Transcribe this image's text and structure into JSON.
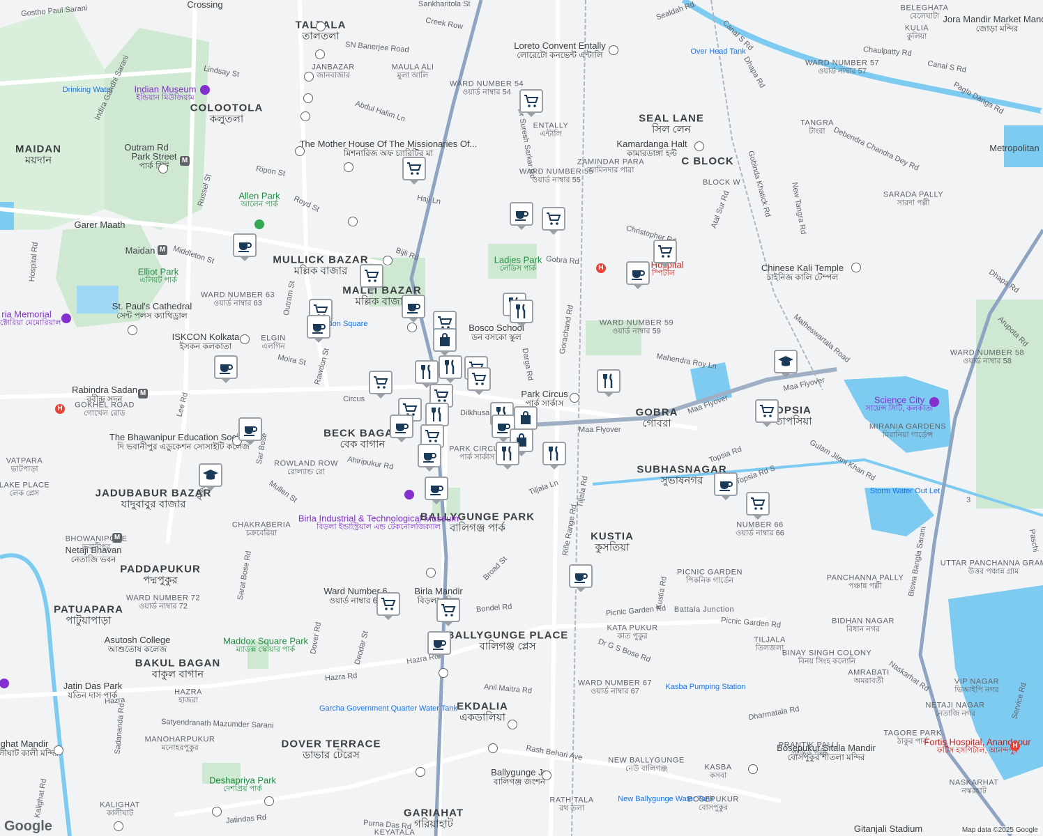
{
  "map": {
    "attribution": "Map data ©2025 Google",
    "logo": "Google",
    "colors": {
      "land": "#f2f3f4",
      "park": "#c8e6c9",
      "water": "#7ecbf1",
      "road": "#ffffff",
      "highway": "#8ea4c0",
      "rail": "#b0b6bd",
      "pin_icon": "#1a3a5a"
    }
  },
  "labels": {
    "taltala": {
      "en": "TALTALA",
      "bn": "তালতলা"
    },
    "colootola": {
      "en": "COLOOTOLA",
      "bn": "কলুতলা"
    },
    "maidan": {
      "en": "MAIDAN",
      "bn": "ময়দান"
    },
    "mullick_bazar": {
      "en": "MULLICK BAZAR",
      "bn": "মল্লিক বাজার"
    },
    "malli_bazar": {
      "en": "MALLI BAZAR",
      "bn": "মল্লিক বাজার"
    },
    "beck_bagan": {
      "en": "BECK BAGAN",
      "bn": "বেক বাগান"
    },
    "ballygunge_park": {
      "en": "BALLYGUNGE PARK",
      "bn": "বালিগঞ্জ পার্ক"
    },
    "ballygunge_place": {
      "en": "BALLYGUNGE PLACE",
      "bn": "বালিগঞ্জ প্লেস"
    },
    "ekdalia": {
      "en": "EKDALIA",
      "bn": "একডালিয়া"
    },
    "dover_terrace": {
      "en": "DOVER TERRACE",
      "bn": "ডাভার টেরেস"
    },
    "gariahat": {
      "en": "GARIAHAT",
      "bn": "গরিয়াহাট"
    },
    "seal_lane": {
      "en": "SEAL LANE",
      "bn": "সিল লেন"
    },
    "gobra": {
      "en": "GOBRA",
      "bn": "গোবরা"
    },
    "topsia": {
      "en": "OPSIA",
      "bn": "তাপসিয়া"
    },
    "subhasnagar": {
      "en": "SUBHASNAGAR",
      "bn": "সুভাষনগর"
    },
    "kustia": {
      "en": "KUSTIA",
      "bn": "কুসতিয়া"
    },
    "jadubabur_bazar": {
      "en": "JADUBABUR BAZAR",
      "bn": "যাদুবাবুর বাজার"
    },
    "paddapukur": {
      "en": "PADDAPUKUR",
      "bn": "পদ্মপুকুর"
    },
    "patuapara": {
      "en": "PATUAPARA",
      "bn": "পাটুয়াপাড়া"
    },
    "bakul_bagan": {
      "en": "BAKUL BAGAN",
      "bn": "বাকুল বাগান"
    },
    "c_block": {
      "en": "C BLOCK"
    },
    "vatpara": {
      "en": "VATPARA",
      "bn": "ভাটপাড়া"
    },
    "lake_place": {
      "en": "LAKE PLACE",
      "bn": "লেক প্লেস"
    },
    "bhowanipore": {
      "en": "BHOWANIPORE",
      "bn": "ভবানীপুর"
    },
    "chakraberia": {
      "en": "CHAKRABERIA",
      "bn": "চক্রবেরিয়া"
    },
    "janbazar": {
      "en": "JANBAZAR",
      "bn": "জানবাজার"
    },
    "maula_ali": {
      "en": "MAULA ALI",
      "bn": "মুলা আলি"
    },
    "entally": {
      "en": "ENTALLY",
      "bn": "এন্টালি"
    },
    "zamindar_para": {
      "en": "ZAMINDAR PARA",
      "bn": "জামিনদার পারা"
    },
    "block_w": {
      "en": "BLOCK W"
    },
    "tangra": {
      "en": "TANGRA",
      "bn": "টাংরা"
    },
    "kulia": {
      "en": "KULIA",
      "bn": "কুলিয়া"
    },
    "beleghata": {
      "en": "BELEGHATA",
      "bn": "বেলেঘাটা"
    },
    "sarada_pally": {
      "en": "SARADA PALLY",
      "bn": "সারদা পল্লী"
    },
    "elgin": {
      "en": "ELGIN",
      "bn": "এলগিন"
    },
    "rowland_row": {
      "en": "ROWLAND ROW",
      "bn": "রোল্যান্ড রো"
    },
    "hazra": {
      "en": "HAZRA",
      "bn": "হাজরা"
    },
    "manoharpukur": {
      "en": "MANOHARPUKUR",
      "bn": "মনোহরপুকুর"
    },
    "kalighat": {
      "en": "KALIGHAT",
      "bn": "কালীঘাট"
    },
    "kata_pukur": {
      "en": "KATA PUKUR",
      "bn": "কাত পুকুর"
    },
    "tiljala": {
      "en": "TILJALA",
      "bn": "তিলজলা"
    },
    "picnic_garden": {
      "en": "PICNIC GARDEN",
      "bn": "পিকনিক গার্ডেন"
    },
    "battala_junction": {
      "en": "Battala Junction"
    },
    "binay_singh_colony": {
      "en": "BINAY SINGH COLONY",
      "bn": "বিনয় সিংহ কলোনি"
    },
    "bidhan_nagar": {
      "en": "BIDHAN NAGAR",
      "bn": "বিধান নগর"
    },
    "amrabati": {
      "en": "AMRABATI",
      "bn": "অমরাবতী"
    },
    "vip_nagar": {
      "en": "VIP NAGAR",
      "bn": "ভিআইপি নগর"
    },
    "netaji_nagar": {
      "en": "NETAJI NAGAR",
      "bn": "নেতাজি নগর"
    },
    "tagore_park": {
      "en": "TAGORE PARK",
      "bn": "ঠাকুর পার্ক"
    },
    "prantik_palli": {
      "en": "PRANTIK PALLI",
      "bn": "প্রান্তিক পল্লী"
    },
    "panchanna_pally": {
      "en": "PANCHANNA PALLY",
      "bn": "পঞ্চান্ন পল্লী"
    },
    "uttar_panchanna_gram": {
      "en": "UTTAR PANCHANNA GRAM",
      "bn": "উত্তর পঞ্চান্ন গ্রাম"
    },
    "kasba": {
      "en": "KASBA",
      "bn": "কসবা"
    },
    "new_ballygunge": {
      "en": "NEW BALLYGUNGE",
      "bn": "নেউ বালিগঞ্জ"
    },
    "bosepukur": {
      "en": "BOSEPUKUR",
      "bn": "বোসপুকুর"
    },
    "rath_tala": {
      "en": "RATH TALA",
      "bn": "রথ তলা"
    },
    "naskarhat": {
      "en": "NASKARHAT",
      "bn": "নস্করহাট"
    },
    "keyatala": {
      "en": "KEYATALA"
    },
    "ward_54": {
      "en": "WARD NUMBER 54",
      "bn": "ওয়ার্ড নাম্বার 54"
    },
    "ward_55": {
      "en": "WARD NUMBER 55",
      "bn": "ওয়ার্ড নাম্বার 55"
    },
    "ward_57": {
      "en": "WARD NUMBER 57",
      "bn": "ওয়ার্ড নাম্বার 57"
    },
    "ward_58": {
      "en": "WARD NUMBER 58",
      "bn": "ওয়ার্ড নাম্বার 58"
    },
    "ward_59": {
      "en": "WARD NUMBER 59",
      "bn": "ওয়ার্ড নাম্বার 59"
    },
    "ward_63": {
      "en": "WARD NUMBER 63",
      "bn": "ওয়ার্ড নাম্বার 63"
    },
    "ward_66": {
      "en": "NUMBER 66",
      "bn": "ওয়ার্ড নাম্বার 66"
    },
    "ward_67": {
      "en": "WARD NUMBER 67",
      "bn": "ওয়ার্ড নাম্বার 67"
    },
    "ward_72": {
      "en": "WARD NUMBER 72",
      "bn": "ওয়ার্ড নাম্বার 72"
    },
    "ward_69": {
      "en": "Ward Number 6",
      "bn": "ওয়ার্ড নাম্বার 69"
    }
  },
  "places": {
    "indian_museum": {
      "en": "Indian Museum",
      "bn": "ইন্ডিয়ান মিউজিয়াম"
    },
    "allen_park": {
      "en": "Allen Park",
      "bn": "আলেন পার্ক"
    },
    "elliot_park": {
      "en": "Elliot Park",
      "bn": "এলিয়ট পার্ক"
    },
    "victoria_memorial": {
      "en": "ria Memorial",
      "bn": "ভিক্টোরিয়া মেমোরিয়াল"
    },
    "st_pauls": {
      "en": "St. Paul's Cathedral",
      "bn": "সেন্ট পলস ক্যাথিড্রাল"
    },
    "iskcon": {
      "en": "ISKCON Kolkata",
      "bn": "ইসকন কলকাতা"
    },
    "rawdon_square": {
      "en": "Rawdon Square"
    },
    "mother_house": {
      "en": "The Mother House Of The Missionaries Of...",
      "bn": "মিশনারিজ অফ চ্যারিটির মা"
    },
    "loreto": {
      "en": "Loreto Convent Entally",
      "bn": "লোরেটো কনভেন্ট এন্টালি"
    },
    "don_bosco": {
      "en": "Bosco School",
      "bn": "ডন বসকো স্কুল"
    },
    "ladies_park": {
      "en": "Ladies Park",
      "bn": "লেডিস পার্ক"
    },
    "park_circus_station": {
      "en": "Park Circus",
      "bn": "পার্ক সার্কাস"
    },
    "park_circus": {
      "en": "PARK CIRCUS",
      "bn": "পার্ক সার্কাস"
    },
    "calcutta_hospital": {
      "en": "Ca          v Hospital",
      "bn": "কল         স্পিটাল"
    },
    "chinese_kali": {
      "en": "Chinese Kali Temple",
      "bn": "চাইনিজ কালি টেম্পল"
    },
    "science_city": {
      "en": "Science City",
      "bn": "সায়েন্স সিটি, কলকাতা"
    },
    "mirania_gardens": {
      "en": "MIRANIA GARDENS",
      "bn": "মিরানিয়া গার্ডেন্স"
    },
    "storm_water": {
      "en": "Storm Water Out Let"
    },
    "kamardanga": {
      "en": "Kamardanga Halt",
      "bn": "কামারডাঙ্গা হল্ট"
    },
    "jora_mandir": {
      "en": "Jora Mandir Market Mandir",
      "bn": "জোড়া মন্দির"
    },
    "metropolitan": {
      "en": "Metropolitan"
    },
    "over_head_tank": {
      "en": "Over Head Tank"
    },
    "drinking_water": {
      "en": "Drinking Water"
    },
    "outram_rd": {
      "en": "Outram Rd"
    },
    "park_street": {
      "en": "Park Street",
      "bn": "পার্ক স্ট্রিট"
    },
    "maidan_metro": {
      "en": "Maidan"
    },
    "garer_maath": {
      "en": "Garer Maath"
    },
    "rabindra_sadan": {
      "en": "Rabindra Sadan",
      "bn": "রবীন্দ্র সদন"
    },
    "gokhel_road": {
      "en": "GOKHEL ROAD",
      "bn": "গোখেল রোড"
    },
    "bhawanipur_college": {
      "en": "The Bhawanipur Education Society...",
      "bn": "দি ভবানীপুর এডুকেশন সোসাইটি কলেজ"
    },
    "netaji_bhavan": {
      "en": "Netaji Bhavan",
      "bn": "নেতাজি ভবন"
    },
    "birla_museum": {
      "en": "Birla Industrial & Technological Museum",
      "bn": "বিড়লা ইন্ডাস্ট্রিয়াল এন্ড টেকনোলজিক্যাল"
    },
    "birla_mandir": {
      "en": "Birla Mandir",
      "bn": "বিড়লা মন্দির"
    },
    "maddox_square": {
      "en": "Maddox Square Park",
      "bn": "ম্যাডক্স স্কোয়ার পার্ক"
    },
    "asutosh_college": {
      "en": "Asutosh College",
      "bn": "আশুতোষ কলেজ"
    },
    "jatin_das_park": {
      "en": "Jatin Das Park",
      "bn": "যতিন দাস পার্ক"
    },
    "garcha_tank": {
      "en": "Garcha Government Quarter Water Tank"
    },
    "kasba_pumping": {
      "en": "Kasba Pumping Station"
    },
    "ballygunge_tank": {
      "en": "New Ballygunge Water Tank"
    },
    "bosepukur_mandir": {
      "en": "Bosepukur Sitala Mandir",
      "bn": "বোসপুকুর শীতলা মন্দির"
    },
    "ballygunge_jn": {
      "en": "Ballygunge Jn",
      "bn": "বালিগঞ্জ জংশন"
    },
    "deshapriya_park": {
      "en": "Deshapriya Park",
      "bn": "দেশপ্রিয় পার্ক"
    },
    "kalighat_mandir": {
      "en": "ghat Mandir",
      "bn": "কালীঘাট কালী মন্দির"
    },
    "fortis": {
      "en": "Fortis Hospital, Anandapur",
      "bn": "ফর্টিস হসপিটাল, আনন্দপুর"
    },
    "gitanjali": {
      "en": "Gitanjali Stadium"
    },
    "crossing": {
      "en": "Crossing"
    }
  },
  "roads": {
    "gostho_paul": "Gostho Paul Sarani",
    "sankharitola": "Sankharitola St",
    "creek_row": "Creek Row",
    "sn_banerjee": "SN Banerjee Road",
    "lindsay": "Lindsay St",
    "abdul_halim": "Abdul Halim Ln",
    "indira_gandhi": "Indira Gandhi Sarani",
    "ripon": "Ripon St",
    "royd": "Royd St",
    "russel": "Russel St",
    "haji": "Haji Ln",
    "middleton": "Middleton St",
    "bijli": "Bijli Rd",
    "hospital_rd": "Hospital Rd",
    "outram_st": "Outram St",
    "moira": "Moira St",
    "rawdon": "Rawdon St",
    "circus": "Circus",
    "dilkhusa": "Dilkhusa",
    "ahiripukur": "Ahiripukur Rd",
    "lee": "Lee Rd",
    "mullen": "Mullen St",
    "sarat_bose": "Sarat Bose Rd",
    "sar_bose": "Sar Bose",
    "allen": "Allen",
    "dover": "Dover Rd",
    "deodar": "Deodar St",
    "hazra": "Hazra Rd",
    "hazra2": "Hazra Rd",
    "hazra3": "Hazra",
    "broad": "Broad St",
    "bondel": "Bondel Rd",
    "anil_maitra": "Anil Maitra Rd",
    "rash_behari": "Rash Behari Ave",
    "purna_das": "Purna Das Rd",
    "jatindas": "Jatindas Rd",
    "satyendranath": "Satyendranath Mazumder Sarani",
    "sadananda": "Sadananda Rd",
    "kalighat_rd": "Kalighat Rd",
    "tiljala_ln": "Tiljala Ln",
    "tiljala_rd": "Tiljala Rd",
    "rifle_range": "Rifle Range Rd",
    "maa_flyover": "Maa Flyover",
    "maa_flyover2": "Maa Flyover",
    "maa_flyover3": "Maa Flyover",
    "topsia_rd": "Topsia Rd",
    "topsia_rd_s": "Topsia Rd S",
    "gulam_jilani": "Gulam Jilani Khan Rd",
    "picnic_garden_rd": "Picnic Garden Rd",
    "picnic_garden_rd2": "Picnic Garden Rd",
    "dr_gs_bose": "Dr G S Bose Rd",
    "dharmatala": "Dharmatala Rd",
    "kustia_rd": "Kustia Rd",
    "naskarhat_rd": "Naskarhat Rd",
    "service_rd": "Service Rd",
    "biswa_bangla": "Biswa Bangla Sarani",
    "mahendra_roy": "Mahendra Roy Ln",
    "matheswartala": "Matheswartala Road",
    "arupota": "Arupota Rd",
    "dhapa": "Dhapa Rd",
    "dhapa2": "Dhapa Rd",
    "gobinda_khatick": "Gobinda Khatick Rd",
    "new_tangra": "New Tangra Rd",
    "atal_sur": "Atal Sur Rd",
    "christopher": "Christopher Rd",
    "gobra_rd": "Gobra Rd",
    "gorachand": "Gorachand Rd",
    "darga": "Darga Rd",
    "dr_suresh": "Dr Suresh Sarkar Rd",
    "chaulpatty": "Chaulpatty Rd",
    "canal_s": "Canal S Rd",
    "canal_s2": "Canal S Rd",
    "pagla_danga": "Pagla Danga Rd",
    "debendra": "Debendra Chandra Dey Rd",
    "sealdah": "Sealdah Rd",
    "paschi": "Paschi",
    "route_3": "3"
  },
  "markers": {
    "icons": [
      "shopping-cart",
      "coffee",
      "restaurant",
      "shopping-bag",
      "school"
    ],
    "list": [
      {
        "type": "shopping-cart",
        "name": "cart-marker"
      },
      {
        "type": "coffee",
        "name": "cafe-marker"
      },
      {
        "type": "restaurant",
        "name": "restaurant-marker"
      },
      {
        "type": "shopping-bag",
        "name": "bag-marker"
      },
      {
        "type": "school",
        "name": "school-marker"
      }
    ]
  }
}
